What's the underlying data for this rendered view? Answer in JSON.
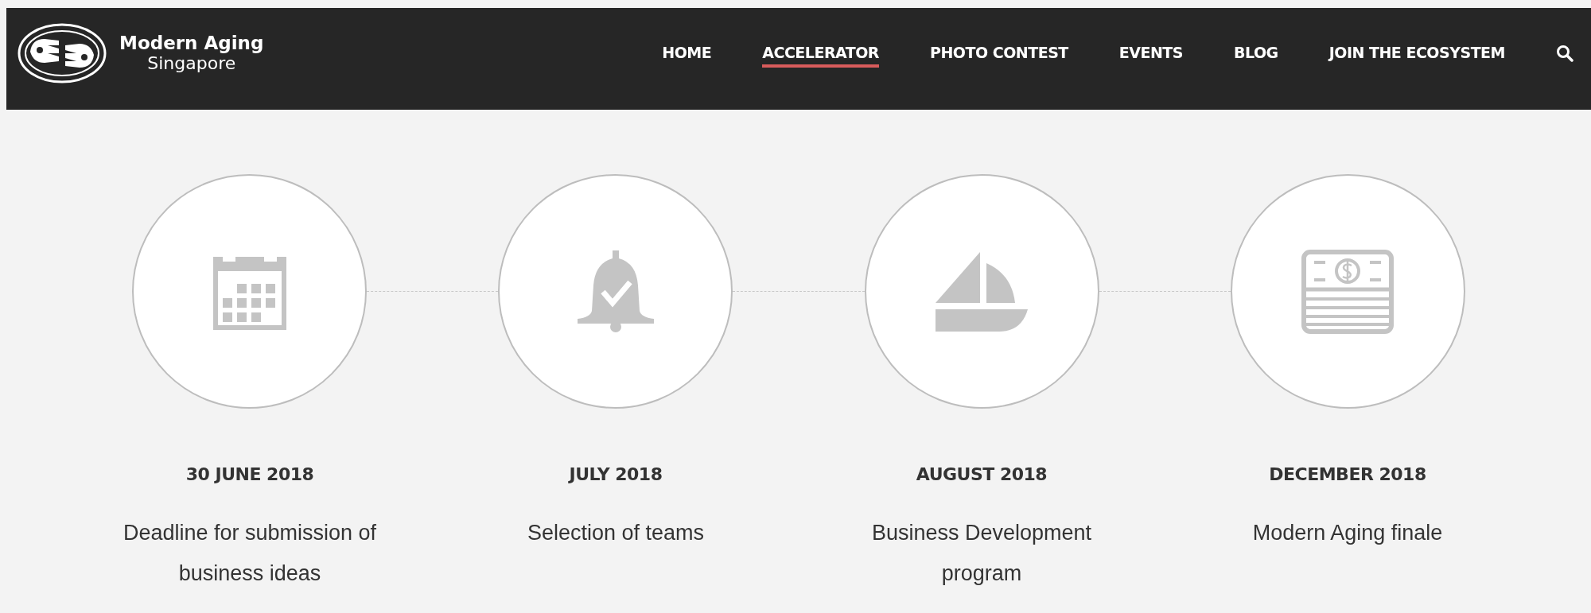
{
  "header": {
    "logo": {
      "title": "Modern Aging",
      "subtitle": "Singapore"
    },
    "nav": [
      {
        "label": "HOME",
        "selected": false
      },
      {
        "label": "ACCELERATOR",
        "selected": true
      },
      {
        "label": "PHOTO CONTEST",
        "selected": false
      },
      {
        "label": "EVENTS",
        "selected": false
      },
      {
        "label": "BLOG",
        "selected": false
      },
      {
        "label": "JOIN THE ECOSYSTEM",
        "selected": false
      }
    ]
  },
  "timeline": [
    {
      "date": "30 JUNE 2018",
      "description": "Deadline for submission of business ideas"
    },
    {
      "date": "JULY 2018",
      "description": "Selection of teams"
    },
    {
      "date": "AUGUST 2018",
      "description": "Business Development program"
    },
    {
      "date": "DECEMBER 2018",
      "description": "Modern Aging finale"
    }
  ]
}
